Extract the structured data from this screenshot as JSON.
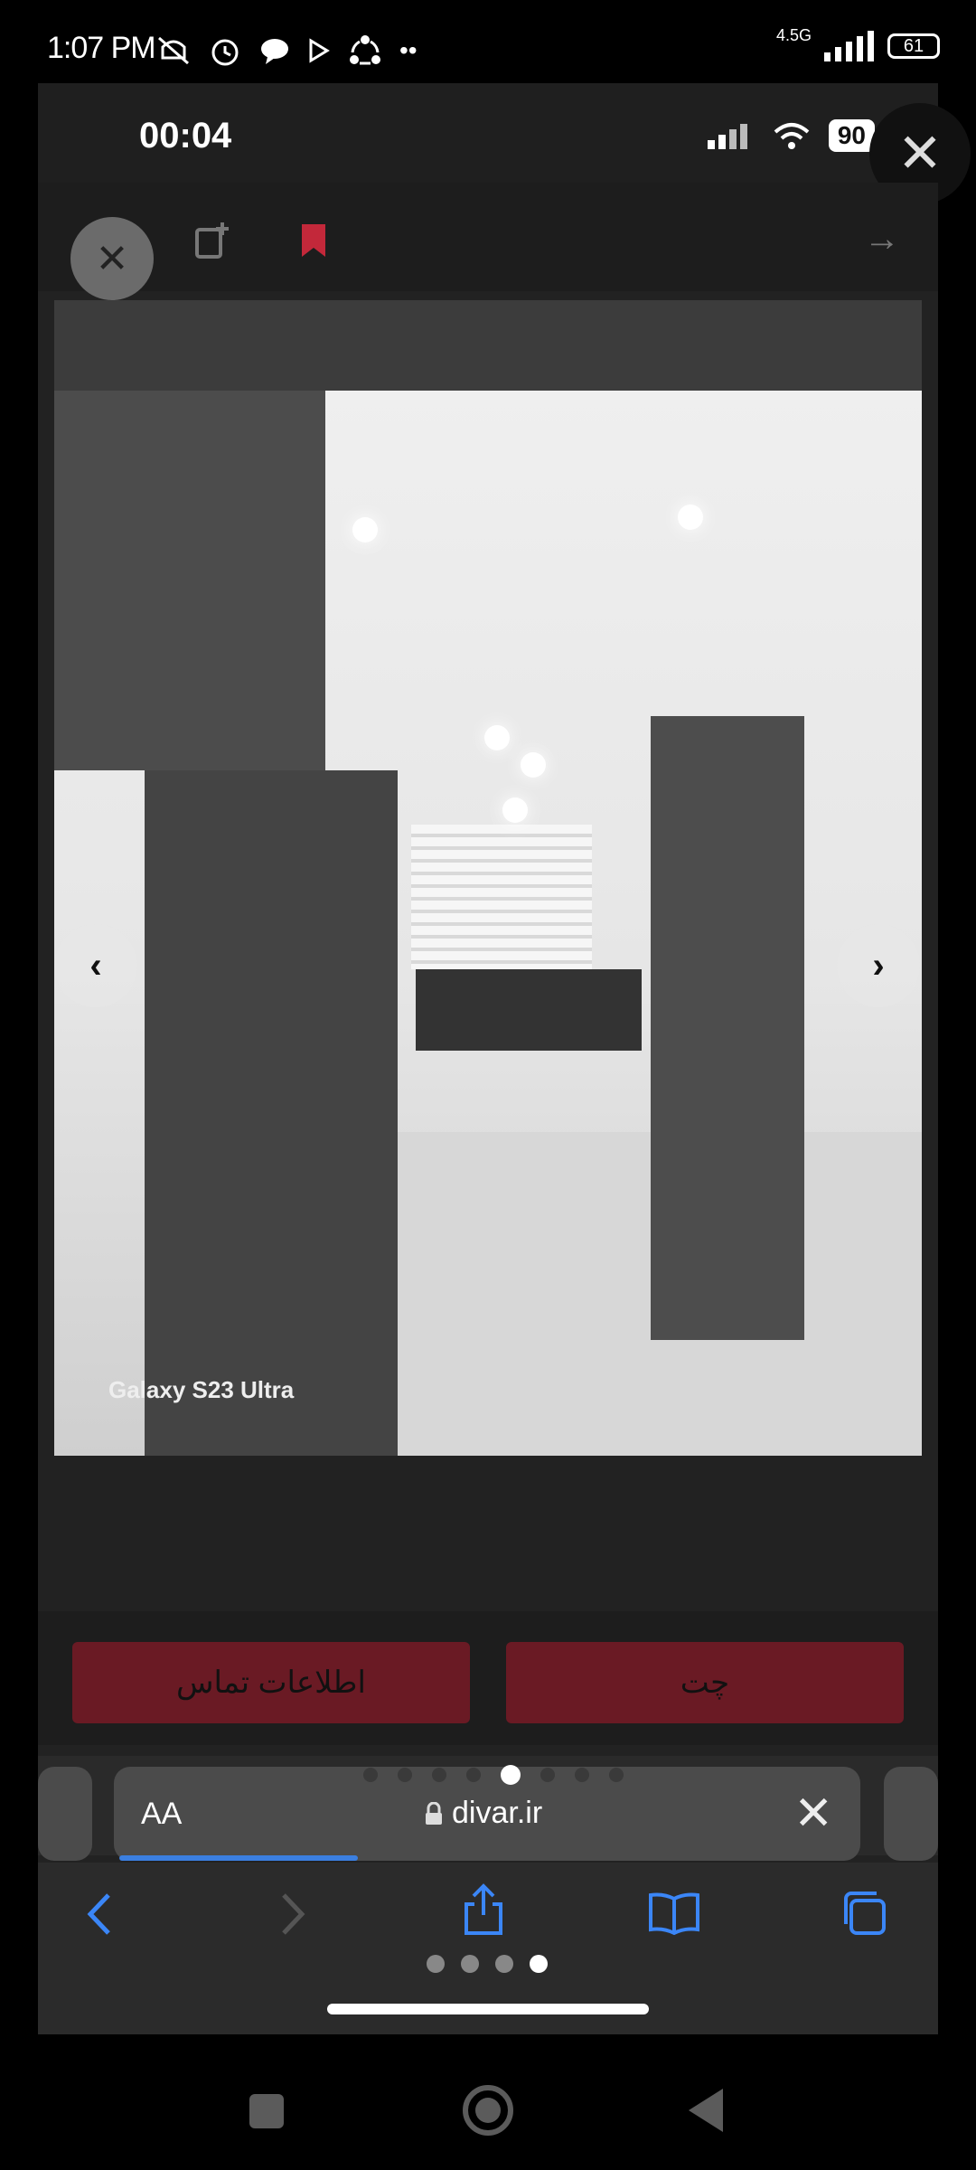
{
  "status_bar": {
    "time": "1:07 PM",
    "network": "4.5G",
    "battery": "61",
    "icons": [
      "mute-icon",
      "alarm-icon",
      "chat-icon",
      "play-icon",
      "share-icon",
      "more-dots-icon"
    ]
  },
  "embedded": {
    "clock": "00:04",
    "battery": "90",
    "close_glyph": "✕",
    "toolbar": {
      "close_glyph": "✕",
      "note_icon": "note-add-icon",
      "bookmark_icon": "bookmark-icon",
      "forward_glyph": "→",
      "bookmark_color": "#c3283a"
    },
    "photo": {
      "watermark": "Galaxy S23 Ultra",
      "prev_glyph": "‹",
      "next_glyph": "›"
    },
    "actions": {
      "contact_label": "اطلاعات تماس",
      "chat_label": "چت",
      "button_color": "#6a1a24",
      "pager": {
        "count": 8,
        "active_index": 4
      }
    },
    "browser": {
      "aa_label": "AA",
      "url": "divar.ir",
      "clear_glyph": "✕",
      "load_progress": 0.32,
      "tab_pages": {
        "count": 4,
        "active_index": 3
      }
    }
  }
}
